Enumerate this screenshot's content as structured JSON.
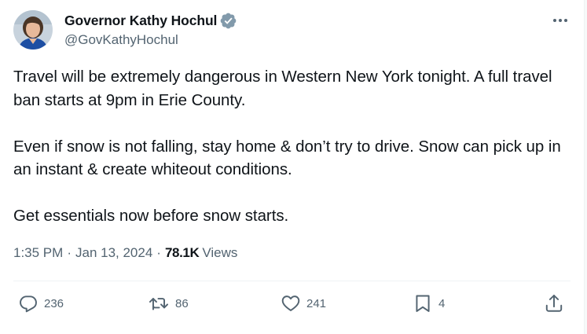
{
  "author": {
    "display_name": "Governor Kathy Hochul",
    "handle": "@GovKathyHochul",
    "verified": true,
    "verified_color": "#829aab"
  },
  "tweet": {
    "paragraphs": [
      "Travel will be extremely dangerous in Western New York tonight. A full travel ban starts at 9pm in Erie County.",
      "Even if snow is not falling, stay home & don’t try to drive. Snow can pick up in an instant & create whiteout conditions.",
      "Get essentials now before snow starts."
    ]
  },
  "meta": {
    "time": "1:35 PM",
    "separator": "·",
    "date": "Jan 13, 2024",
    "views_count": "78.1K",
    "views_label": "Views"
  },
  "actions": {
    "reply": {
      "icon": "reply-icon",
      "count": "236"
    },
    "retweet": {
      "icon": "retweet-icon",
      "count": "86"
    },
    "like": {
      "icon": "heart-icon",
      "count": "241"
    },
    "bookmark": {
      "icon": "bookmark-icon",
      "count": "4"
    },
    "share": {
      "icon": "share-icon"
    }
  },
  "colors": {
    "text_primary": "#0f1419",
    "text_secondary": "#536471",
    "divider": "#eff3f4"
  }
}
